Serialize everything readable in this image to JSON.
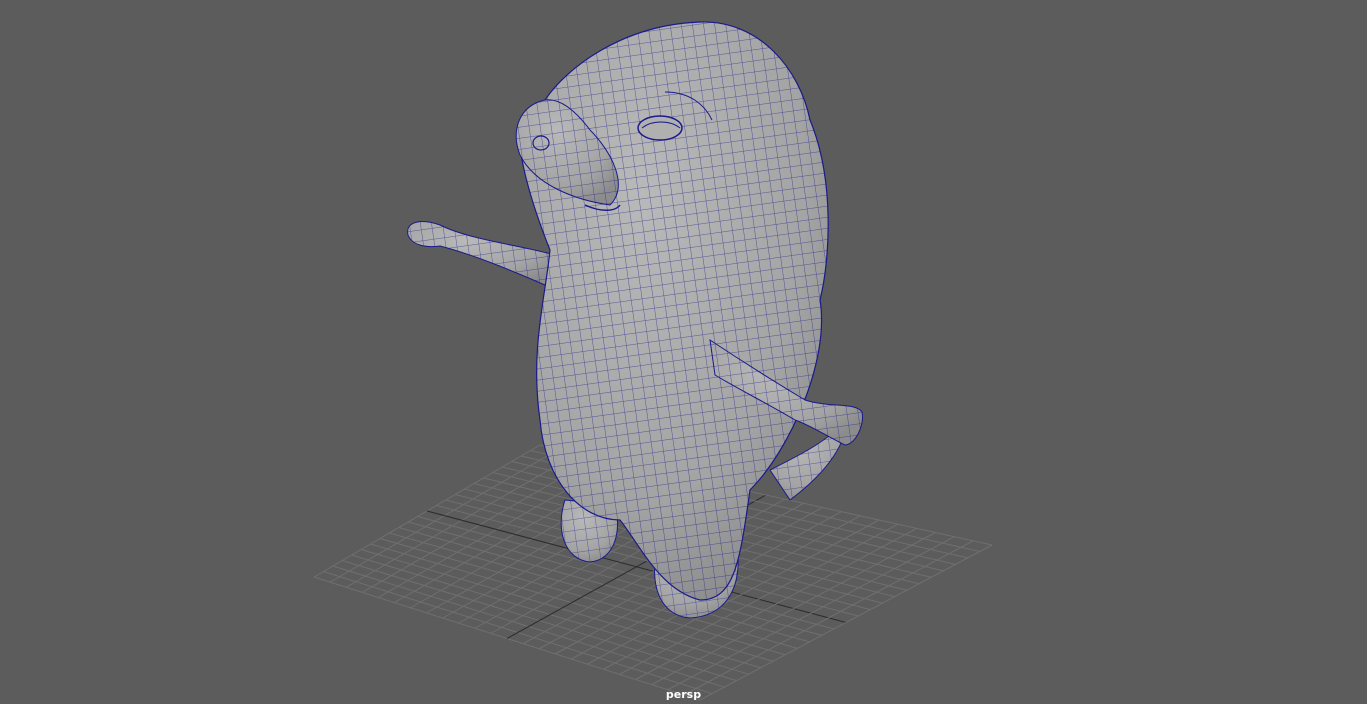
{
  "viewport": {
    "camera_name": "persp",
    "colors": {
      "background": "#5c5c5c",
      "grid_line": "#6f6f6f",
      "mesh_fill": "#a7a7a7",
      "wireframe": "#1a1a8c"
    }
  }
}
